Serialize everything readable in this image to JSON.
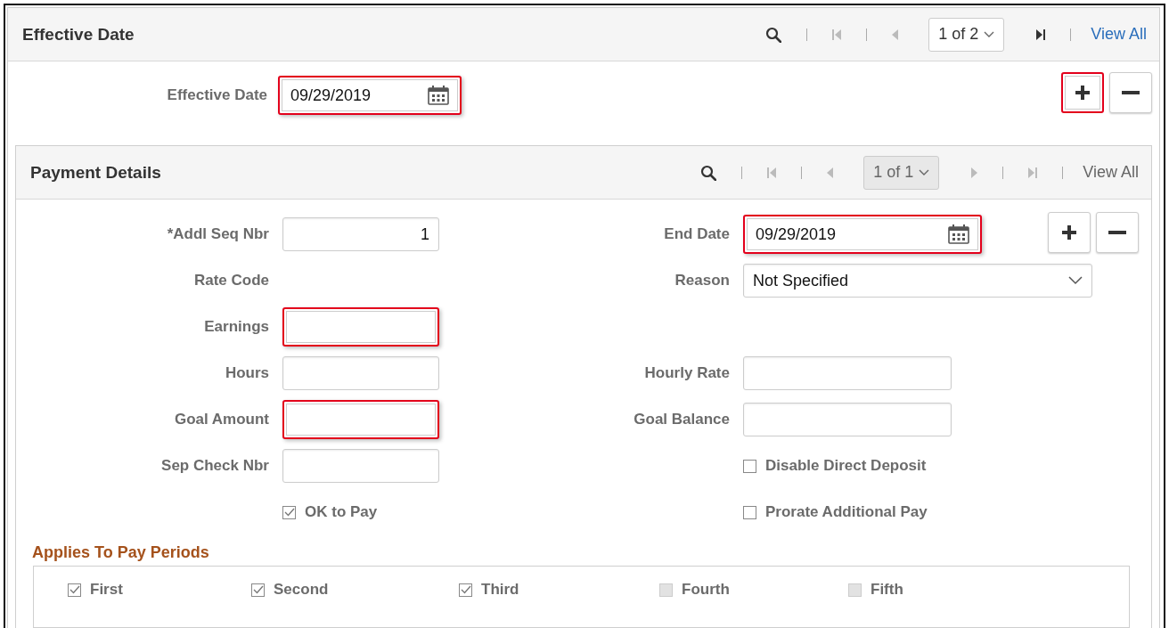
{
  "effective_date_section": {
    "title": "Effective Date",
    "nav": [
      {
        "kind": "search",
        "disabled": false
      },
      {
        "kind": "first",
        "disabled": true
      },
      {
        "kind": "prev",
        "disabled": true
      },
      {
        "kind": "pager",
        "text": "1 of 2",
        "disabled": false
      },
      {
        "kind": "last",
        "disabled": false
      },
      {
        "kind": "view_all",
        "text": "View All",
        "disabled": false
      }
    ],
    "field": {
      "label": "Effective Date",
      "value": "09/29/2019",
      "kind": "date",
      "highlighted": true
    },
    "add_button": {
      "highlighted": true
    },
    "remove_button": {
      "highlighted": false
    }
  },
  "payment_details": {
    "title": "Payment Details",
    "nav": [
      {
        "kind": "search",
        "disabled": false
      },
      {
        "kind": "first",
        "disabled": true
      },
      {
        "kind": "prev",
        "disabled": true
      },
      {
        "kind": "pager",
        "text": "1 of 1",
        "disabled": true
      },
      {
        "kind": "next",
        "disabled": true
      },
      {
        "kind": "last",
        "disabled": true
      },
      {
        "kind": "view_all",
        "text": "View All",
        "disabled": true
      }
    ],
    "add_button": {
      "highlighted": false
    },
    "remove_button": {
      "highlighted": false
    },
    "rows": [
      {
        "left": {
          "kind": "number",
          "label": "*Addl Seq Nbr",
          "value": "1",
          "highlighted": false
        },
        "right": {
          "kind": "date",
          "label": "End Date",
          "value": "09/29/2019",
          "highlighted": true
        }
      },
      {
        "left": {
          "kind": "label",
          "label": "Rate Code"
        },
        "right": {
          "kind": "select",
          "label": "Reason",
          "value": "Not Specified",
          "highlighted": false
        }
      },
      {
        "left": {
          "kind": "text",
          "label": "Earnings",
          "highlighted": true
        }
      },
      {
        "left": {
          "kind": "text",
          "label": "Hours",
          "highlighted": false
        },
        "right": {
          "kind": "text",
          "label": "Hourly Rate",
          "highlighted": false
        }
      },
      {
        "left": {
          "kind": "text",
          "label": "Goal Amount",
          "highlighted": true
        },
        "right": {
          "kind": "text",
          "label": "Goal Balance",
          "highlighted": false
        }
      },
      {
        "left": {
          "kind": "text",
          "label": "Sep Check Nbr",
          "highlighted": false
        },
        "right": {
          "kind": "checkbox",
          "label": "Disable Direct Deposit",
          "checked": false,
          "disabled": false
        }
      },
      {
        "left": {
          "kind": "checkbox",
          "label": "OK to Pay",
          "checked": true,
          "disabled": false
        },
        "right": {
          "kind": "checkbox",
          "label": "Prorate Additional Pay",
          "checked": false,
          "disabled": false
        }
      }
    ],
    "pay_periods": {
      "title": "Applies To Pay Periods",
      "items": [
        {
          "label": "First",
          "checked": true,
          "disabled": false
        },
        {
          "label": "Second",
          "checked": true,
          "disabled": false
        },
        {
          "label": "Third",
          "checked": true,
          "disabled": false
        },
        {
          "label": "Fourth",
          "checked": false,
          "disabled": true
        },
        {
          "label": "Fifth",
          "checked": false,
          "disabled": true
        }
      ]
    }
  }
}
